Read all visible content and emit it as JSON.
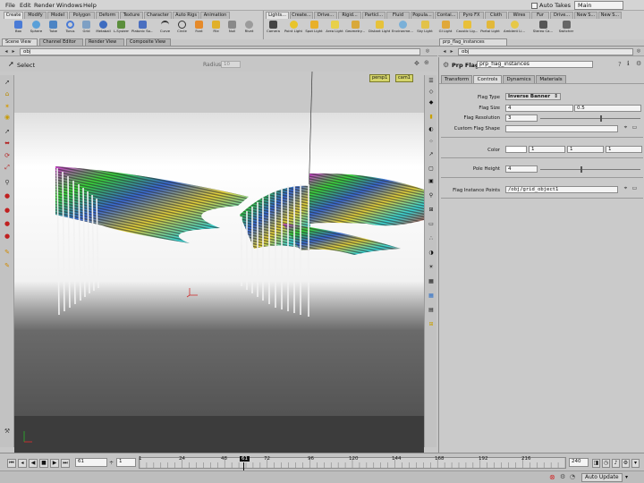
{
  "menubar": {
    "items": [
      "File",
      "Edit",
      "Render",
      "Windows",
      "Help"
    ],
    "auto_takes": "Auto Takes",
    "desktop": "Main"
  },
  "shelf_left": {
    "tabs": [
      "Create",
      "Modify",
      "Model",
      "Polygon",
      "Deform",
      "Texture",
      "Character",
      "Auto Rigs",
      "Animation"
    ],
    "tools": [
      "Box",
      "Sphere",
      "Tube",
      "Torus",
      "Grid",
      "Metaball",
      "L-System",
      "Platonic So...",
      "Curve",
      "Circle",
      "Font",
      "File",
      "Null",
      "Rivet"
    ]
  },
  "shelf_right": {
    "tabs": [
      "Lights...",
      "Create...",
      "Drive...",
      "Rigid...",
      "Particl...",
      "Fluid",
      "Popula...",
      "Contai...",
      "Pyro FX",
      "Cloth",
      "Wires",
      "Fur",
      "Drive...",
      "New S...",
      "New S..."
    ],
    "tools": [
      "Camera",
      "Point Light",
      "Spot Light",
      "Area Light",
      "Geometry...",
      "Distant Light",
      "Environme...",
      "Sky Light",
      "GI Light",
      "Caustic Lig...",
      "Portal Light",
      "Ambient Li...",
      "Stereo Ca...",
      "Switcher"
    ]
  },
  "pane_tabs": [
    "Scene View",
    "Channel Editor",
    "Render View",
    "Composite View"
  ],
  "param_pane_tab": "prp_flag_instances",
  "viewport_path": "obj",
  "params_path": "obj",
  "viewport": {
    "tool_label": "Select",
    "radius_label": "Radius",
    "radius_value": "10",
    "view_menu": "persp1",
    "cam_menu": "cam1"
  },
  "params": {
    "node_type": "Prp Flag",
    "node_name": "prp_flag_instances",
    "tabs": [
      "Transform",
      "Controls",
      "Dynamics",
      "Materials"
    ],
    "active_tab": "Controls",
    "flag_type_label": "Flag Type",
    "flag_type_value": "Inverse Banner",
    "flag_size_label": "Flag Size",
    "flag_size_x": "4",
    "flag_size_y": "0.5",
    "flag_res_label": "Flag Resolution",
    "flag_res_value": "3",
    "flag_res_level": 0.6,
    "custom_shape_label": "Custom Flag Shape",
    "custom_shape_value": "",
    "color_label": "Color",
    "color_r": "1",
    "color_g": "1",
    "color_b": "1",
    "pole_height_label": "Pole Height",
    "pole_height_value": "4",
    "pole_height_level": 0.4,
    "instance_points_label": "Flag Instance Points",
    "instance_points_value": "/obj/grid_object1"
  },
  "timeline": {
    "current_frame": "61",
    "start_frame": "1",
    "end_frame": "240",
    "ticks": [
      "1",
      "24",
      "48",
      "61",
      "72",
      "96",
      "120",
      "144",
      "168",
      "192",
      "216"
    ]
  },
  "status": {
    "auto_update": "Auto Update"
  },
  "colors": {
    "accent": "#2b6fc9",
    "cam_menu": "#d4d46a"
  }
}
